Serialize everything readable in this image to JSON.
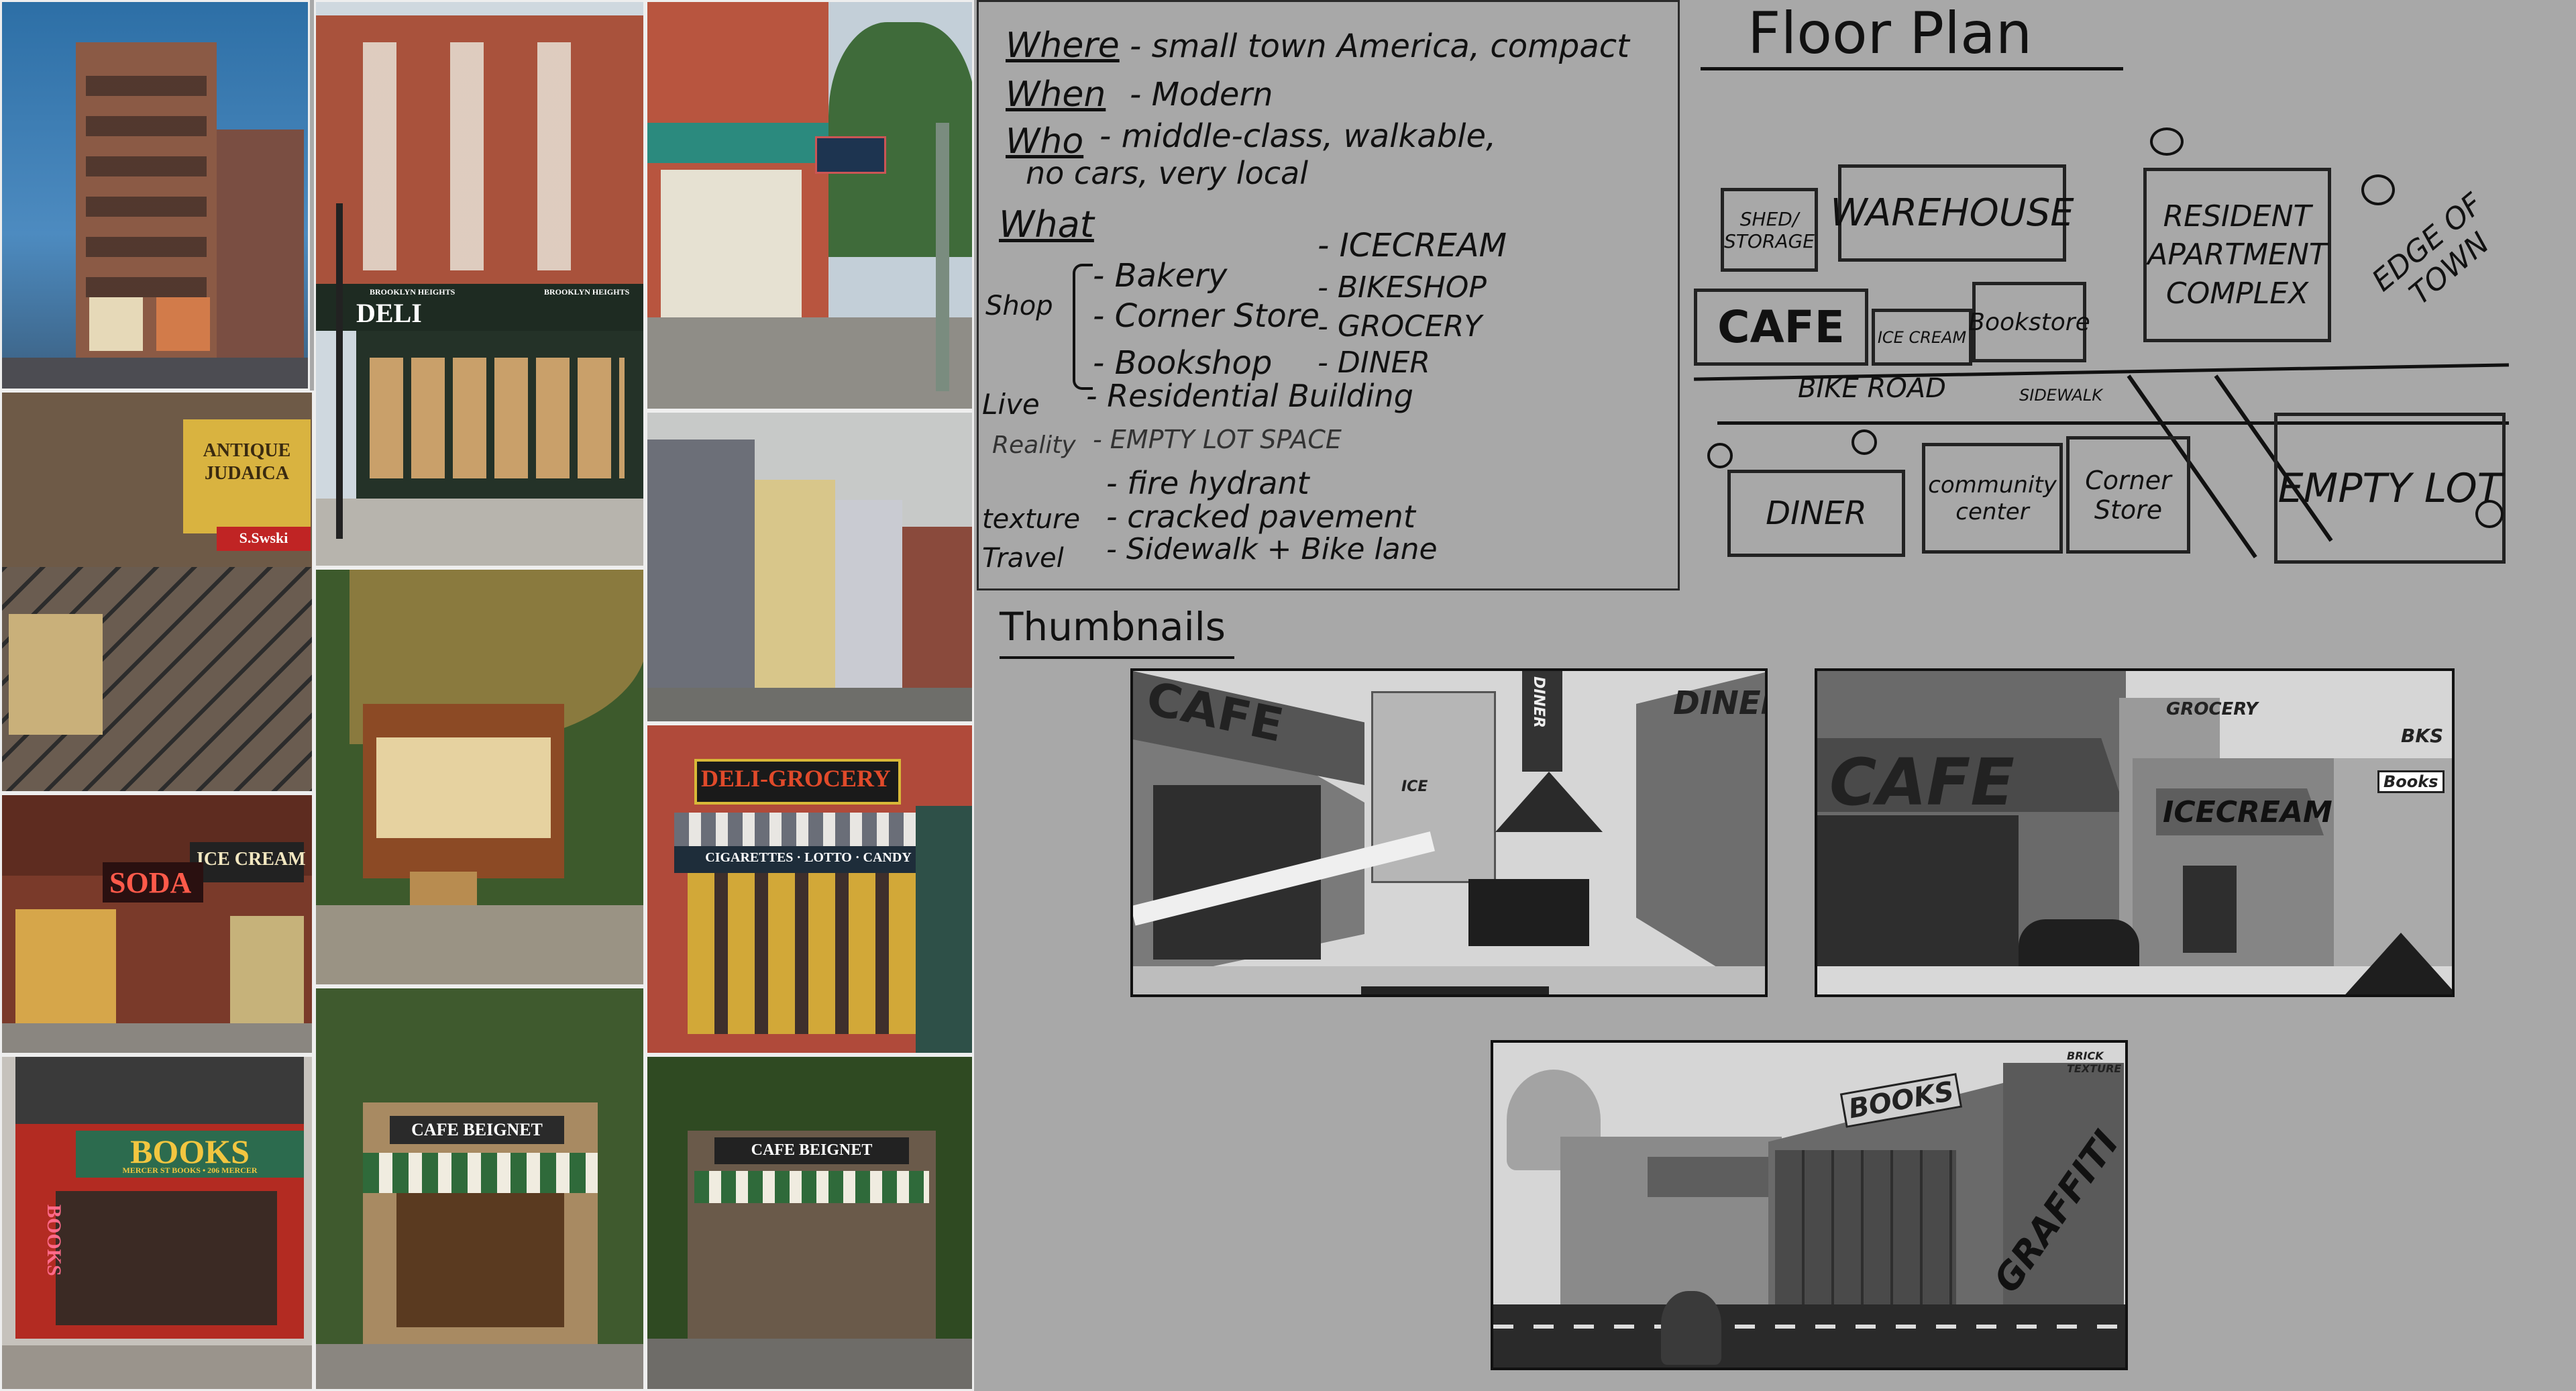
{
  "photos": {
    "signs": {
      "deli_main": "DELI",
      "deli_left": "BROOKLYN HEIGHTS",
      "deli_right": "BROOKLYN HEIGHTS",
      "antiques": "ANTIQUE JUDAICA",
      "sawski": "S.Swski",
      "soda": "SODA",
      "ice_cream": "ICE CREAM",
      "books": "BOOKS",
      "books_sub": "MERCER ST BOOKS • 206 MERCER",
      "books_vertical": "BOOKS",
      "deli_grocery": "DELI-GROCERY",
      "cigarettes": "CIGARETTES · LOTTO · CANDY",
      "cafe_beignet_1": "CAFE BEIGNET",
      "cafe_beignet_2": "CAFE BEIGNET"
    }
  },
  "notes": {
    "where_label": "Where",
    "where_text": "- small town America, compact",
    "when_label": "When",
    "when_text": "- Modern",
    "who_label": "Who",
    "who_text": "- middle-class, walkable,",
    "who_text2": "no cars, very local",
    "what_label": "What",
    "shop_label": "Shop",
    "shop_items": [
      "- Bakery",
      "- Corner Store",
      "- Bookshop"
    ],
    "shop_items2": [
      "- ICECREAM",
      "- BIKESHOP",
      "- GROCERY",
      "- DINER"
    ],
    "live_label": "Live",
    "live_text": "- Residential Building",
    "reality_label": "Reality",
    "reality_text": "- EMPTY LOT SPACE",
    "texture_label": "texture",
    "texture_text1": "- fire hydrant",
    "texture_text2": "- cracked pavement",
    "travel_label": "Travel",
    "travel_text": "- Sidewalk + Bike lane"
  },
  "floor_plan": {
    "title": "Floor Plan",
    "shed": "SHED/ STORAGE",
    "warehouse": "WAREHOUSE",
    "resident": "RESIDENT APARTMENT COMPLEX",
    "edge": "EDGE OF TOWN",
    "cafe": "CAFE",
    "icecream": "ICE CREAM",
    "bookstore": "Bookstore",
    "bike_road": "BIKE ROAD",
    "sidewalk": "SIDEWALK",
    "diner": "DINER",
    "community": "community center",
    "corner": "Corner Store",
    "empty_lot": "EMPTY LOT"
  },
  "thumbnails": {
    "title": "Thumbnails",
    "t1_cafe": "CAFE",
    "t1_diner": "DINER",
    "t1_diner_vertical": "DINER",
    "t1_ice": "ICE",
    "t2_cafe": "CAFE",
    "t2_grocery": "GROCERY",
    "t2_icecream": "ICECREAM",
    "t2_books": "Books",
    "t2_bks": "BKS",
    "t3_books": "BOOKS",
    "t3_graffiti": "GRAFFITI",
    "t3_brick": "BRICK TEXTURE"
  }
}
